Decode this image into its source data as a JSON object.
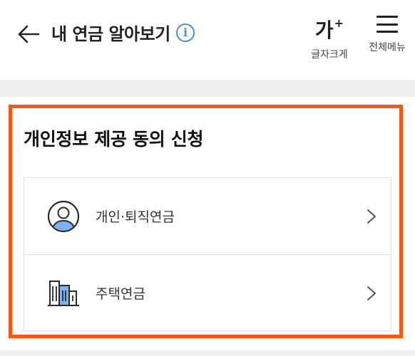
{
  "header": {
    "title": "내 연금 알아보기",
    "info_icon": "i",
    "font_size": {
      "glyph": "가",
      "superscript": "+",
      "label": "글자크게"
    },
    "menu": {
      "label": "전체메뉴"
    }
  },
  "section": {
    "title": "개인정보 제공 동의 신청",
    "items": [
      {
        "label": "개인·퇴직연금",
        "icon": "person-avatar-icon"
      },
      {
        "label": "주택연금",
        "icon": "buildings-icon"
      }
    ]
  },
  "colors": {
    "highlight": "#f25a12",
    "info_blue": "#4a8fe0",
    "icon_blue": "#7fb0f0",
    "background_gray": "#efefef"
  }
}
